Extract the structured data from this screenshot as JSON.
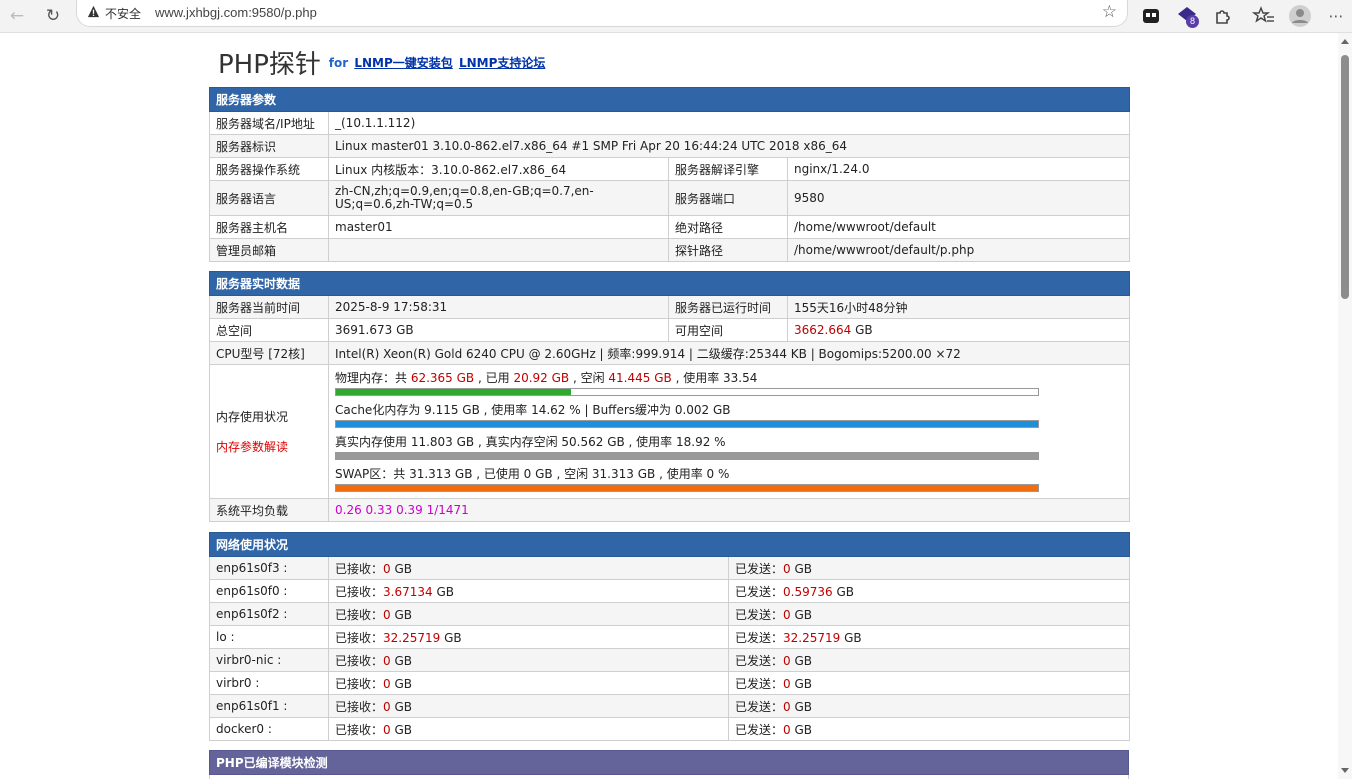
{
  "browser": {
    "insecure_label": "不安全",
    "url": "www.jxhbgj.com:9580/p.php",
    "extension_badge": "8"
  },
  "header": {
    "title": "PHP探针",
    "for_label": "for",
    "link1": "LNMP一键安装包",
    "link2": "LNMP支持论坛"
  },
  "server_params": {
    "heading": "服务器参数",
    "domain_ip_label": "服务器域名/IP地址",
    "domain_ip_value": "_(10.1.1.112)",
    "ident_label": "服务器标识",
    "ident_value": "Linux master01 3.10.0-862.el7.x86_64 #1 SMP Fri Apr 20 16:44:24 UTC 2018 x86_64",
    "os_label": "服务器操作系统",
    "os_value": "Linux  内核版本：3.10.0-862.el7.x86_64",
    "engine_label": "服务器解译引擎",
    "engine_value": "nginx/1.24.0",
    "lang_label": "服务器语言",
    "lang_value": "zh-CN,zh;q=0.9,en;q=0.8,en-GB;q=0.7,en-US;q=0.6,zh-TW;q=0.5",
    "port_label": "服务器端口",
    "port_value": "9580",
    "hostname_label": "服务器主机名",
    "hostname_value": "master01",
    "abspath_label": "绝对路径",
    "abspath_value": "/home/wwwroot/default",
    "admin_label": "管理员邮箱",
    "admin_value": "",
    "probe_path_label": "探针路径",
    "probe_path_value": "/home/wwwroot/default/p.php"
  },
  "realtime": {
    "heading": "服务器实时数据",
    "time_label": "服务器当前时间",
    "time_value": "2025-8-9 17:58:31",
    "uptime_label": "服务器已运行时间",
    "uptime_value": "155天16小时48分钟",
    "total_space_label": "总空间",
    "total_space_value": "3691.673 GB",
    "free_space_label": "可用空间",
    "free_space_num": "3662.664",
    "free_space_unit": " GB",
    "cpu_label": "CPU型号 [72核]",
    "cpu_value": "Intel(R) Xeon(R) Gold 6240 CPU @ 2.60GHz | 频率:999.914 | 二级缓存:25344 KB | Bogomips:5200.00 ×72",
    "mem_label": "内存使用状况",
    "mem_help": "内存参数解读",
    "mem": {
      "phys_a": "物理内存：共 ",
      "phys_total": "62.365 GB",
      "phys_b": " , 已用 ",
      "phys_used": "20.92 GB",
      "phys_c": " , 空闲 ",
      "phys_free": "41.445 GB",
      "phys_d": " , 使用率 33.54",
      "phys_pct": 0.3354,
      "cache_text": "Cache化内存为 9.115 GB , 使用率 14.62 % | Buffers缓冲为 0.002 GB",
      "cache_pct": 1.0,
      "real_text": "真实内存使用 11.803 GB , 真实内存空闲 50.562 GB , 使用率 18.92 %",
      "real_pct": 1.0,
      "swap_text": "SWAP区：共 31.313 GB , 已使用 0 GB , 空闲 31.313 GB , 使用率 0 %",
      "swap_pct": 1.0
    },
    "load_label": "系统平均负载",
    "load_value": "0.26 0.33 0.39 1/1471"
  },
  "network": {
    "heading": "网络使用状况",
    "recv_prefix": "已接收：",
    "send_prefix": "已发送：",
    "unit": " GB",
    "rows": [
      {
        "iface": "enp61s0f3 :",
        "recv": "0",
        "sent": "0"
      },
      {
        "iface": "enp61s0f0 :",
        "recv": "3.67134",
        "sent": "0.59736"
      },
      {
        "iface": "enp61s0f2 :",
        "recv": "0",
        "sent": "0"
      },
      {
        "iface": "lo :",
        "recv": "32.25719",
        "sent": "32.25719"
      },
      {
        "iface": "virbr0-nic :",
        "recv": "0",
        "sent": "0"
      },
      {
        "iface": "virbr0 :",
        "recv": "0",
        "sent": "0"
      },
      {
        "iface": "enp61s0f1 :",
        "recv": "0",
        "sent": "0"
      },
      {
        "iface": "docker0 :",
        "recv": "0",
        "sent": "0"
      }
    ]
  },
  "modules": {
    "heading": "PHP已编译模块检测"
  },
  "colors": {
    "section_header": "#3066a8",
    "phys_bar": "#2eaa2e",
    "cache_bar": "#1f8fdc",
    "real_bar": "#999999",
    "swap_bar": "#f26c10"
  }
}
